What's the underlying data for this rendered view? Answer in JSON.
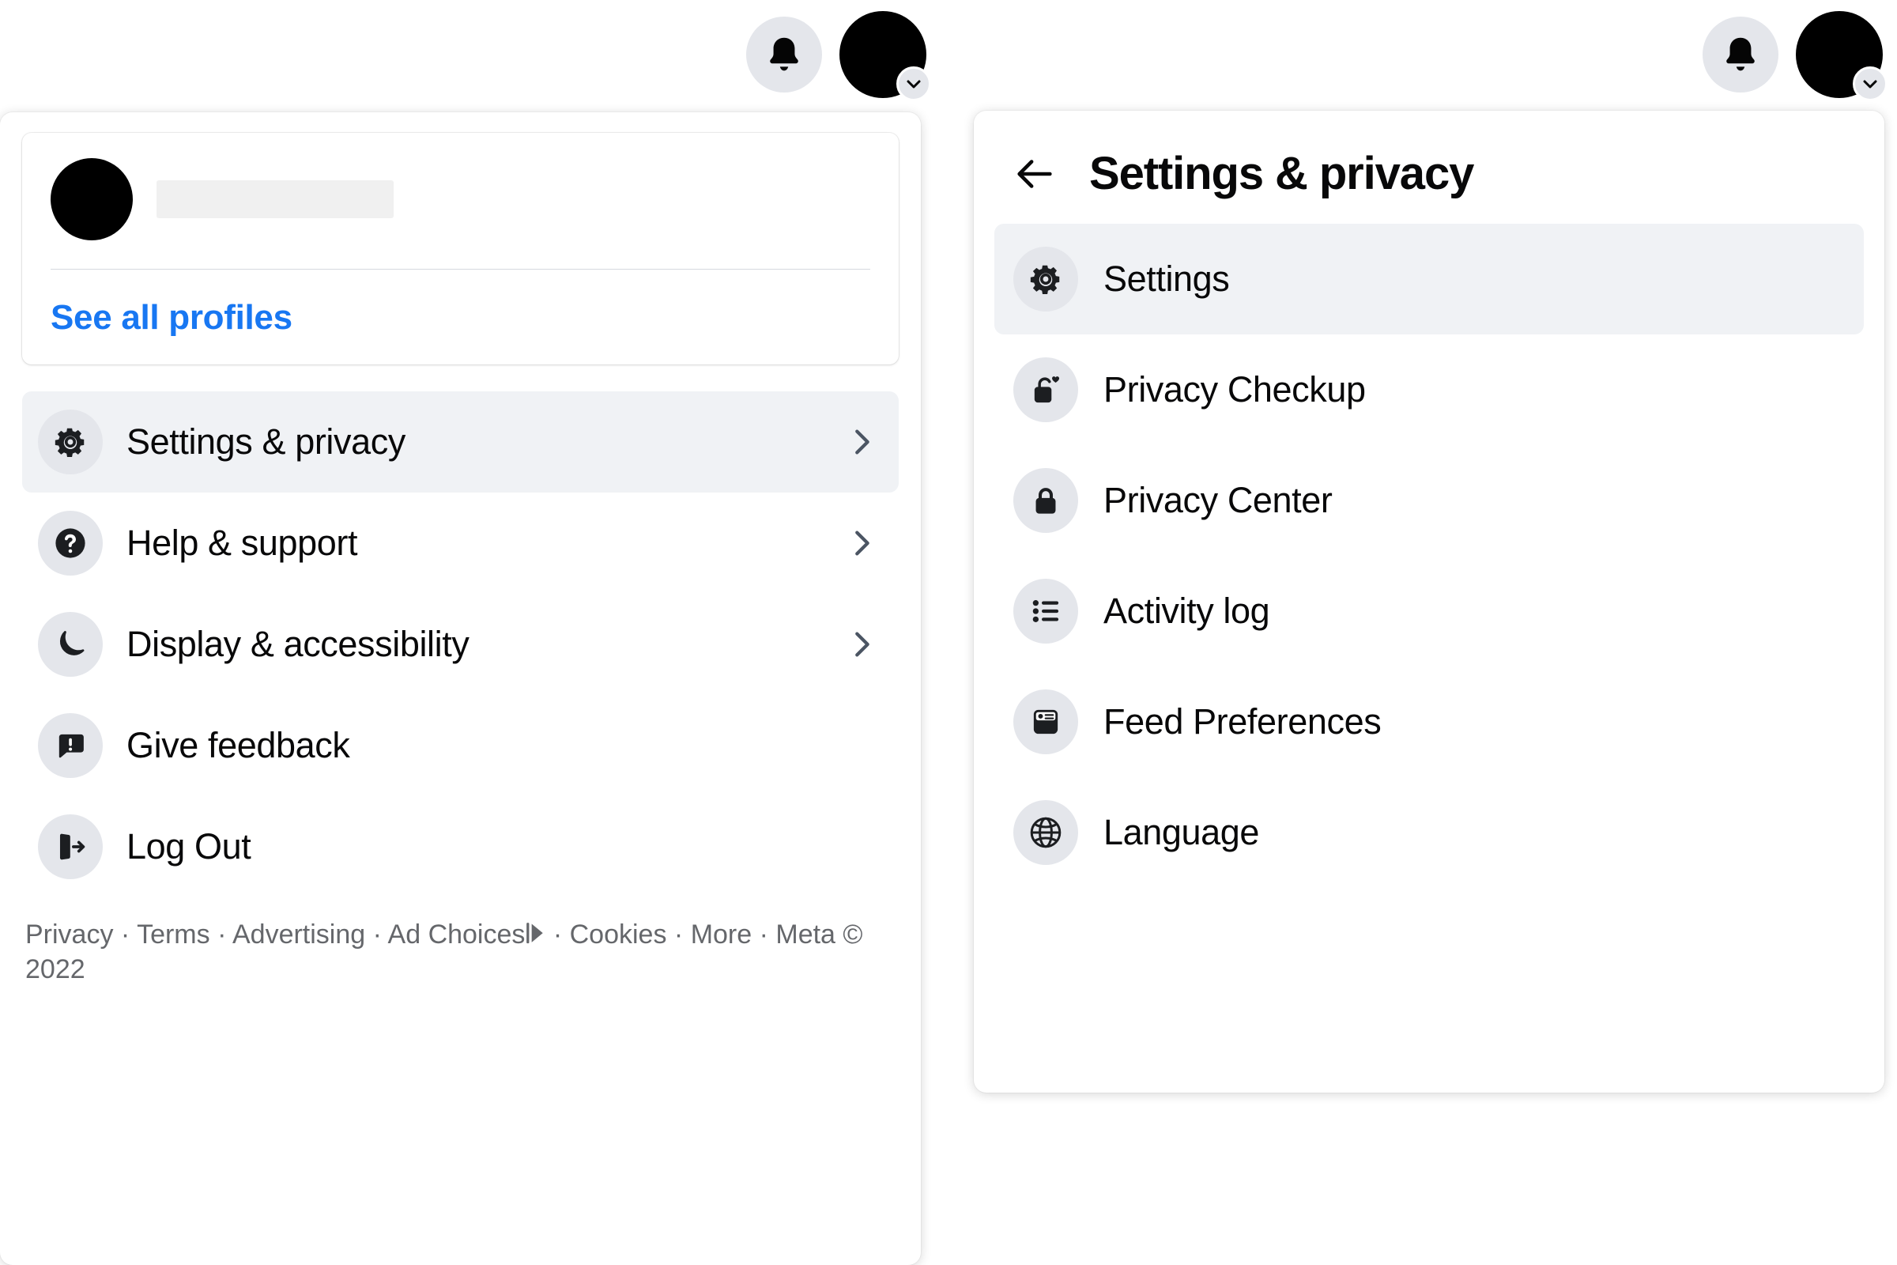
{
  "topbar": {
    "notifications_icon": "bell-icon",
    "account_icon": "avatar",
    "account_chevron_icon": "chevron-down-icon"
  },
  "left_panel": {
    "profile_card": {
      "avatar_icon": "avatar",
      "name_redacted": "",
      "see_all_profiles_label": "See all profiles"
    },
    "menu_items": [
      {
        "label": "Settings & privacy",
        "icon": "gear-icon",
        "active": true,
        "chevron": true
      },
      {
        "label": "Help & support",
        "icon": "question-mark-icon",
        "active": false,
        "chevron": true
      },
      {
        "label": "Display & accessibility",
        "icon": "moon-icon",
        "active": false,
        "chevron": true
      },
      {
        "label": "Give feedback",
        "icon": "feedback-bubble-icon",
        "active": false,
        "chevron": false
      },
      {
        "label": "Log Out",
        "icon": "logout-icon",
        "active": false,
        "chevron": false
      }
    ],
    "footer": {
      "privacy": "Privacy",
      "terms": "Terms",
      "advertising": "Advertising",
      "ad_choices": "Ad Choices",
      "ad_choices_icon": "adchoices-triangle-icon",
      "cookies": "Cookies",
      "more": "More",
      "copyright": "Meta © 2022",
      "separator": "·"
    }
  },
  "right_panel": {
    "back_icon": "arrow-left-icon",
    "title": "Settings & privacy",
    "menu_items": [
      {
        "label": "Settings",
        "icon": "gear-icon",
        "active": true
      },
      {
        "label": "Privacy Checkup",
        "icon": "lock-heart-icon",
        "active": false
      },
      {
        "label": "Privacy Center",
        "icon": "lock-icon",
        "active": false
      },
      {
        "label": "Activity log",
        "icon": "list-icon",
        "active": false
      },
      {
        "label": "Feed Preferences",
        "icon": "feed-card-icon",
        "active": false
      },
      {
        "label": "Language",
        "icon": "globe-icon",
        "active": false
      }
    ]
  },
  "colors": {
    "link_blue": "#1877f2",
    "row_highlight": "#f0f2f5",
    "icon_circle": "#e4e6eb",
    "text_primary": "#080809",
    "text_secondary": "#65676b",
    "chevron": "#4b5563"
  }
}
